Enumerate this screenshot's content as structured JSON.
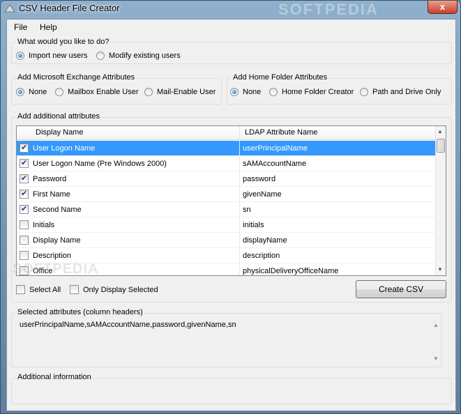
{
  "window": {
    "title": "CSV Header File Creator",
    "close_glyph": "x",
    "watermark": "SOFTPEDIA",
    "watermark_overlay": "SOFTPEDIA"
  },
  "menu": {
    "items": [
      "File",
      "Help"
    ]
  },
  "action_group": {
    "label": "What would you like to do?",
    "options": [
      {
        "label": "Import new users",
        "selected": true
      },
      {
        "label": "Modify existing users",
        "selected": false
      }
    ]
  },
  "exchange_group": {
    "label": "Add Microsoft Exchange Attributes",
    "options": [
      {
        "label": "None",
        "selected": true
      },
      {
        "label": "Mailbox Enable User",
        "selected": false
      },
      {
        "label": "Mail-Enable User",
        "selected": false
      }
    ]
  },
  "home_group": {
    "label": "Add Home Folder Attributes",
    "options": [
      {
        "label": "None",
        "selected": true
      },
      {
        "label": "Home Folder Creator",
        "selected": false
      },
      {
        "label": "Path and Drive Only",
        "selected": false
      }
    ]
  },
  "attributes_group": {
    "label": "Add additional attributes",
    "columns": [
      "Display Name",
      "LDAP Attribute Name"
    ],
    "rows": [
      {
        "display": "User Logon Name",
        "ldap": "userPrincipalName",
        "checked": true,
        "selected": true
      },
      {
        "display": "User Logon Name (Pre Windows 2000)",
        "ldap": "sAMAccountName",
        "checked": true,
        "selected": false
      },
      {
        "display": "Password",
        "ldap": "password",
        "checked": true,
        "selected": false
      },
      {
        "display": "First Name",
        "ldap": "givenName",
        "checked": true,
        "selected": false
      },
      {
        "display": "Second Name",
        "ldap": "sn",
        "checked": true,
        "selected": false
      },
      {
        "display": "Initials",
        "ldap": "initials",
        "checked": false,
        "selected": false
      },
      {
        "display": "Display Name",
        "ldap": "displayName",
        "checked": false,
        "selected": false
      },
      {
        "display": "Description",
        "ldap": "description",
        "checked": false,
        "selected": false
      },
      {
        "display": "Office",
        "ldap": "physicalDeliveryOfficeName",
        "checked": false,
        "selected": false
      }
    ],
    "select_all_label": "Select All",
    "only_selected_label": "Only Display Selected",
    "create_button_label": "Create CSV"
  },
  "selected_attributes": {
    "label": "Selected attributes (column headers)",
    "value": "userPrincipalName,sAMAccountName,password,givenName,sn"
  },
  "additional_info": {
    "label": "Additional information"
  }
}
